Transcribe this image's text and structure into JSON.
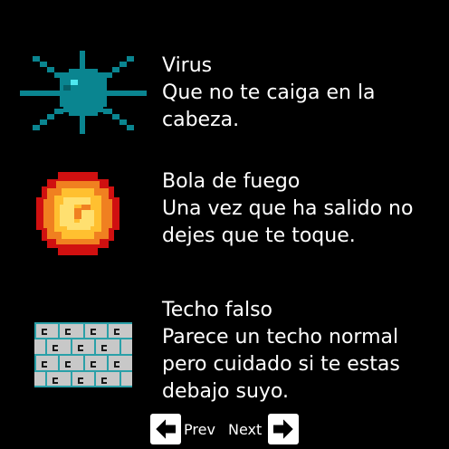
{
  "entries": [
    {
      "icon": "virus-icon",
      "title": "Virus",
      "description": "Que no te caiga en la\ncabeza."
    },
    {
      "icon": "fireball-icon",
      "title": "Bola de fuego",
      "description": "Una vez que ha salido no\ndejes que te toque."
    },
    {
      "icon": "brick-ceiling-icon",
      "title": "Techo falso",
      "description": "Parece un techo normal\npero cuidado si te estas\ndebajo suyo."
    }
  ],
  "nav": {
    "prev_label": "Prev",
    "next_label": "Next"
  },
  "colors": {
    "background": "#000000",
    "text": "#ffffff",
    "virus": "#0a8590",
    "fire_outer": "#d01010",
    "fire_mid": "#f08020",
    "fire_inner": "#ffe070",
    "brick_fill": "#c8c8c8",
    "brick_edge": "#2aa0a8"
  }
}
